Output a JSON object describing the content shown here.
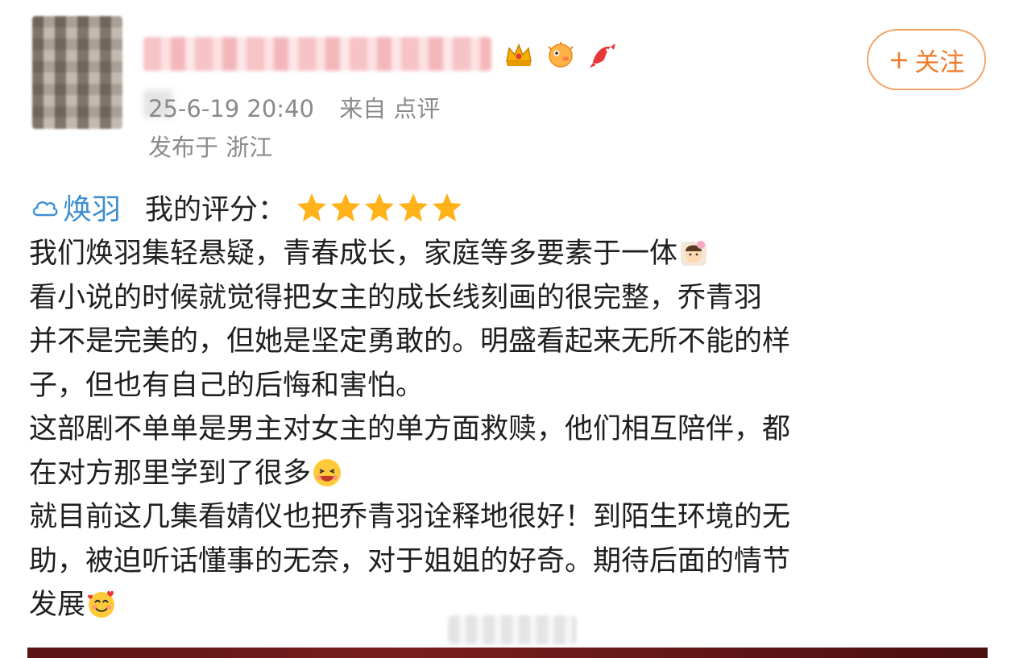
{
  "post": {
    "username": "",
    "badges": [
      "crown-badge-icon",
      "pufferfish-badge-icon",
      "koi-badge-icon"
    ],
    "datetime": "25-6-19 20:40",
    "source": "来自 点评",
    "location": "发布于 浙江",
    "follow_label": "关注",
    "follow_plus": "+"
  },
  "rating": {
    "brand": "焕羽",
    "label": "我的评分：",
    "stars": 5
  },
  "review": {
    "lines": [
      "我们焕羽集轻悬疑，青春成长，家庭等多要素于一体",
      "  看小说的时候就觉得把女主的成长线刻画的很完整，乔青羽",
      "并不是完美的，但她是坚定勇敢的。明盛看起来无所不能的样",
      "子，但也有自己的后悔和害怕。",
      "  这部剧不单单是男主对女主的单方面救赎，他们相互陪伴，都",
      "在对方那里学到了很多",
      "  就目前这几集看婧仪也把乔青羽诠释地很好！到陌生环境的无",
      "助，被迫听话懂事的无奈，对于姐姐的好奇。期待后面的情节",
      "发展"
    ]
  },
  "colors": {
    "accent": "#f07c2a",
    "brand_blue": "#3e8fd1",
    "meta_gray": "#8a8a8a",
    "star": "#ffb21a"
  }
}
